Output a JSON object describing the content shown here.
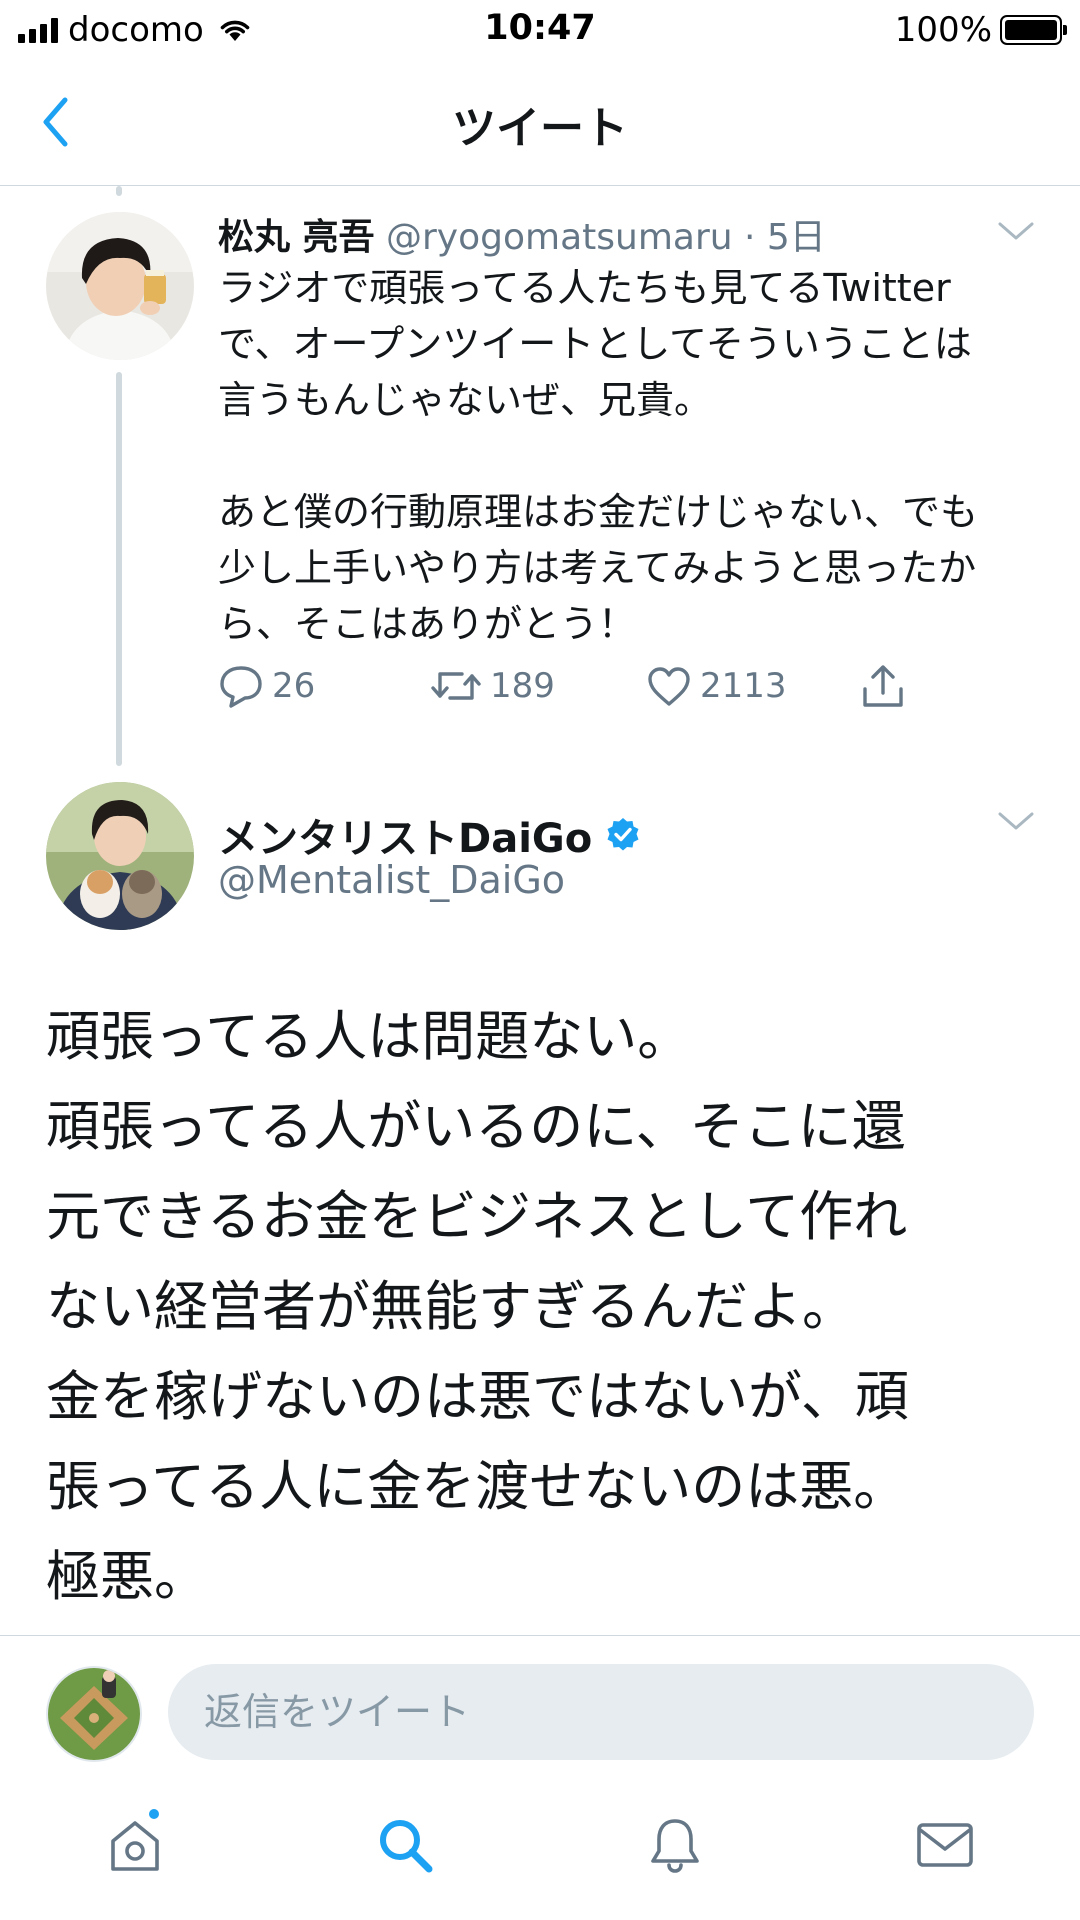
{
  "status_bar": {
    "carrier": "docomo",
    "time": "10:47",
    "battery": "100%"
  },
  "nav": {
    "title": "ツイート"
  },
  "parent_tweet": {
    "author_name": "松丸 亮吾",
    "handle_time": "@ryogomatsumaru · 5日",
    "body_lines": [
      "ラジオで頑張ってる人たちも見てるTwitter",
      "で、オープンツイートとしてそういうことは",
      "言うもんじゃないぜ、兄貴。",
      "",
      "あと僕の行動原理はお金だけじゃない、でも",
      "少し上手いやり方は考えてみようと思ったか",
      "ら、そこはありがとう！"
    ],
    "reply_count": "26",
    "retweet_count": "189",
    "like_count": "2113"
  },
  "main_tweet": {
    "author_name": "メンタリストDaiGo",
    "handle": "@Mentalist_DaiGo",
    "body_lines": [
      "頑張ってる人は問題ない。",
      "頑張ってる人がいるのに、そこに還",
      "元できるお金をビジネスとして作れ",
      "ない経営者が無能すぎるんだよ。",
      "金を稼げないのは悪ではないが、頑",
      "張ってる人に金を渡せないのは悪。",
      "極悪。"
    ]
  },
  "reply": {
    "placeholder": "返信をツイート"
  },
  "tabs": [
    "home-icon",
    "search-icon",
    "bell-icon",
    "mail-icon"
  ],
  "colors": {
    "accent": "#1da1f2",
    "secondary_text": "#657786",
    "verified": "#1da1f2"
  }
}
